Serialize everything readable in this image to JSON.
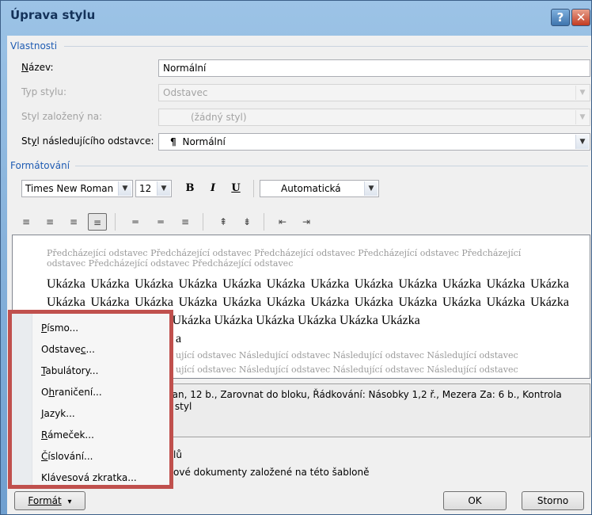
{
  "window": {
    "title": "Úprava stylu",
    "help_glyph": "?",
    "close_glyph": "✕"
  },
  "properties": {
    "group_title": "Vlastnosti",
    "name_label": "Název:",
    "name_value": "Normální",
    "type_label": "Typ stylu:",
    "type_value": "Odstavec",
    "based_label": "Styl založený na:",
    "based_value": "(žádný styl)",
    "next_label": "Styl následujícího odstavce:",
    "next_value": "Normální",
    "pilcrow": "¶"
  },
  "formatting": {
    "group_title": "Formátování",
    "font": "Times New Roman",
    "size": "12",
    "bold": "B",
    "italic": "I",
    "underline": "U",
    "color": "Automatická"
  },
  "preview": {
    "previous_text": "Předcházející odstavec Předcházející odstavec Předcházející odstavec Předcházející odstavec Předcházející odstavec Předcházející odstavec Předcházející odstavec",
    "sample_visible": "Ukázka Ukázka Ukázka Ukázka Ukázka Ukázka Ukázka Ukázka Ukázka Ukázka Ukázka Ukázka Ukázka Ukázka Ukázka Ukázka Ukázka Ukázka Ukázka Ukázka Ukázka Ukázka Ukázka Ukázka Ukázka Ukázka Ukázka Ukázka Ukázka Ukázka Ukázka Ukázka Ukázka",
    "sample_tail": "a",
    "following_line1": "ující odstavec Následující odstavec Následující odstavec Následující odstavec",
    "following_line2": "ující odstavec Následující odstavec Následující odstavec Následující odstavec"
  },
  "description": {
    "line1": "nan, 12 b., Zarovnat do bloku, Řádkování:  Násobky 1,2 ř., Mezera Za:  6 b., Kontrola",
    "line2": "ý styl"
  },
  "options": {
    "quick_styles": "lů",
    "template_docs": "ové dokumenty založené na této šabloně"
  },
  "buttons": {
    "format": "Formát",
    "format_caret": "▾",
    "ok": "OK",
    "cancel": "Storno"
  },
  "format_menu": [
    {
      "pre": "",
      "acc": "P",
      "post": "ísmo..."
    },
    {
      "pre": "Odstave",
      "acc": "c",
      "post": "..."
    },
    {
      "pre": "",
      "acc": "T",
      "post": "abulátory..."
    },
    {
      "pre": "O",
      "acc": "h",
      "post": "raničení..."
    },
    {
      "pre": "",
      "acc": "J",
      "post": "azyk..."
    },
    {
      "pre": "",
      "acc": "R",
      "post": "ámeček..."
    },
    {
      "pre": "",
      "acc": "Č",
      "post": "íslování..."
    },
    {
      "pre": "Klávesová zkratka",
      "acc": "",
      "post": "..."
    }
  ],
  "colors": {
    "accent_blue": "#1f5cb3",
    "highlight_red": "#c0504d"
  }
}
